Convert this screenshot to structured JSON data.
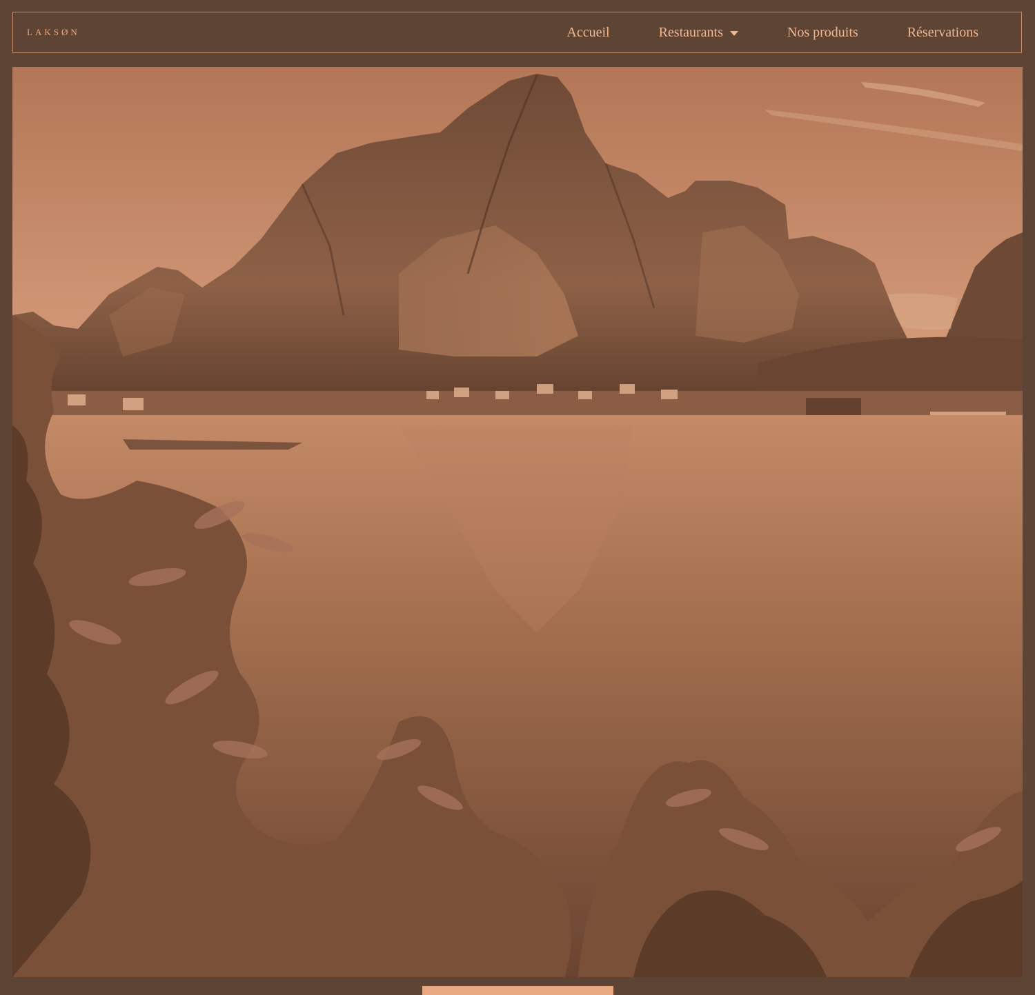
{
  "brand": {
    "logo_text": "LAKSØN"
  },
  "nav": {
    "items": [
      {
        "label": "Accueil"
      },
      {
        "label": "Restaurants",
        "has_dropdown": true
      },
      {
        "label": "Nos produits"
      },
      {
        "label": "Réservations"
      }
    ]
  },
  "hero": {
    "image_subject": "mountain-fjord-village-landscape"
  },
  "colors": {
    "background": "#5e4434",
    "accent": "#e8a882",
    "nav_text": "#f0b793",
    "border": "#c98c67"
  },
  "icons": {
    "dropdown": "chevron-down-icon"
  }
}
